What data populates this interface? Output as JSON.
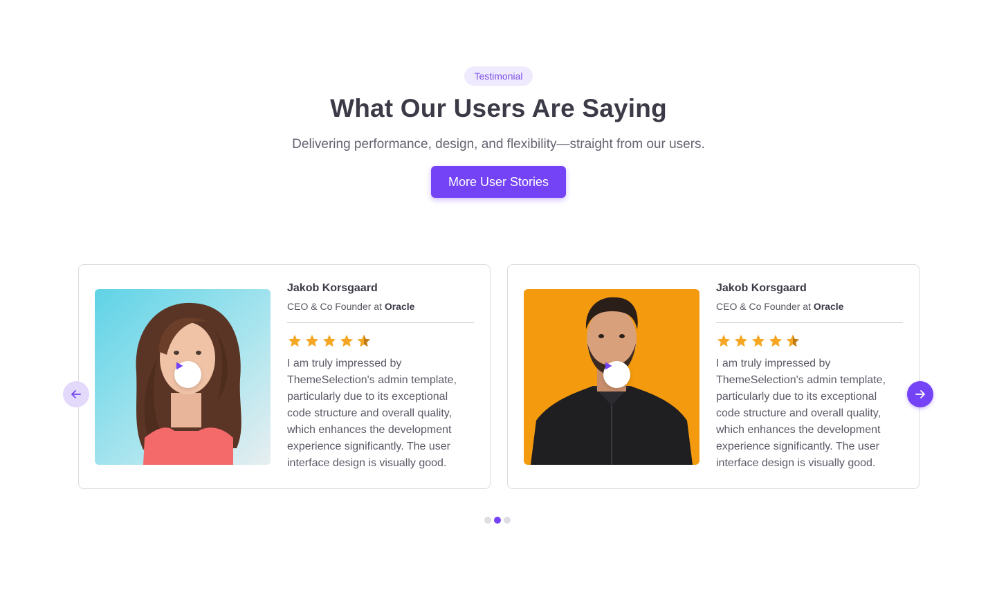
{
  "header": {
    "badge": "Testimonial",
    "title": "What Our Users Are Saying",
    "subtitle": "Delivering performance, design, and flexibility—straight from our users.",
    "cta_label": "More User Stories"
  },
  "colors": {
    "accent": "#7443F5",
    "badge_bg": "#EFEAFD",
    "star": "#F5A623"
  },
  "testimonials": [
    {
      "name": "Jakob Korsgaard",
      "role_prefix": "CEO & Co Founder at",
      "company": "Oracle",
      "rating": 4.5,
      "quote": "I am truly impressed by ThemeSelection's admin template, particularly due to its exceptional code structure and overall quality, which enhances the development experience significantly. The user interface design is visually good."
    },
    {
      "name": "Jakob Korsgaard",
      "role_prefix": "CEO & Co Founder at",
      "company": "Oracle",
      "rating": 4.5,
      "quote": "I am truly impressed by ThemeSelection's admin template, particularly due to its exceptional code structure and overall quality, which enhances the development experience significantly. The user interface design is visually good."
    }
  ],
  "icons": {
    "prev": "arrow-left-icon",
    "next": "arrow-right-icon",
    "play": "play-icon",
    "star": "star-icon"
  },
  "pagination": {
    "count": 3,
    "active_index": 1
  }
}
